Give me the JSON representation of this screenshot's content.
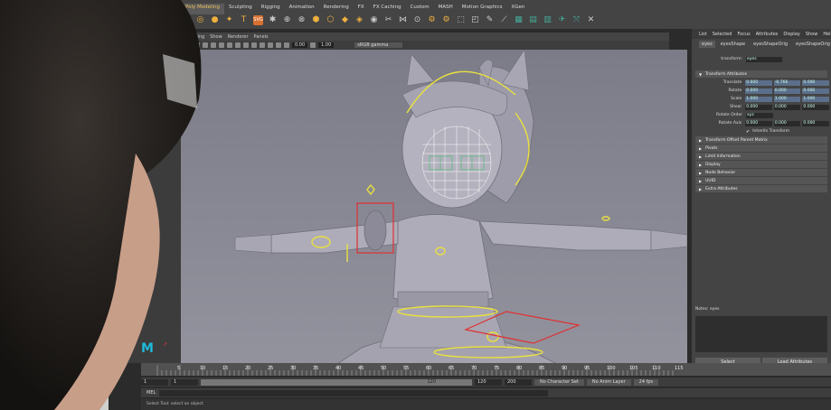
{
  "shelf_tabs": [
    "Poly Modeling",
    "Sculpting",
    "Rigging",
    "Animation",
    "Rendering",
    "FX",
    "FX Caching",
    "Custom",
    "MASH",
    "Motion Graphics",
    "XGen"
  ],
  "active_shelf_tab": 0,
  "viewport_menu": [
    "Lighting",
    "Show",
    "Renderer",
    "Panels"
  ],
  "viewport_toolbar": {
    "value_a": "0.00",
    "value_b": "1.00",
    "color_space": "sRGB gamma"
  },
  "attribute_editor": {
    "menu": [
      "List",
      "Selected",
      "Focus",
      "Attributes",
      "Display",
      "Show",
      "Help"
    ],
    "tabs": [
      "eyes",
      "eyesShape",
      "eyesShapeOrig",
      "eyesShapeOrig"
    ],
    "transform_label": "transform:",
    "transform_value": "eyes",
    "transform_attributes_header": "Transform Attributes",
    "rows": [
      {
        "label": "Translate",
        "values": [
          "0.000",
          "-0.766",
          "0.000"
        ]
      },
      {
        "label": "Rotate",
        "values": [
          "0.000",
          "0.000",
          "0.000"
        ]
      },
      {
        "label": "Scale",
        "values": [
          "1.000",
          "1.000",
          "1.000"
        ]
      },
      {
        "label": "Shear",
        "values": [
          "0.000",
          "0.000",
          "0.000"
        ]
      },
      {
        "label": "Rotate Order",
        "values": [
          "xyz"
        ]
      },
      {
        "label": "Rotate Axis",
        "values": [
          "0.000",
          "0.000",
          "0.000"
        ]
      }
    ],
    "inherits_transform": "Inherits Transform",
    "sections": [
      "Transform Offset Parent Matrix",
      "Pivots",
      "Limit Information",
      "Display",
      "Node Behavior",
      "UUID",
      "Extra Attributes"
    ],
    "notes_label": "Notes: eyes",
    "buttons": [
      "Select",
      "Load Attributes"
    ]
  },
  "timeline": {
    "ticks": [
      "5",
      "10",
      "15",
      "20",
      "25",
      "30",
      "35",
      "40",
      "45",
      "50",
      "55",
      "60",
      "65",
      "70",
      "75",
      "80",
      "85",
      "90",
      "95",
      "100",
      "105",
      "110",
      "115"
    ],
    "current_frame": "1"
  },
  "range": {
    "start": "1",
    "start_inner": "1",
    "end_inner": "120",
    "end": "120",
    "end_total": "200"
  },
  "bottom": {
    "mel": "MEL",
    "character_set": "No Character Set",
    "anim_layer": "No Anim Layer",
    "fps": "24 fps"
  },
  "help_line": "Select Tool: select an object",
  "colors": {
    "viewport_bg": "#8a8a96",
    "maya_logo": "#1fb8d8",
    "control_curve_yellow": "#e8e040",
    "control_curve_red": "#e03030",
    "mesh_wire_green": "#40c070"
  }
}
